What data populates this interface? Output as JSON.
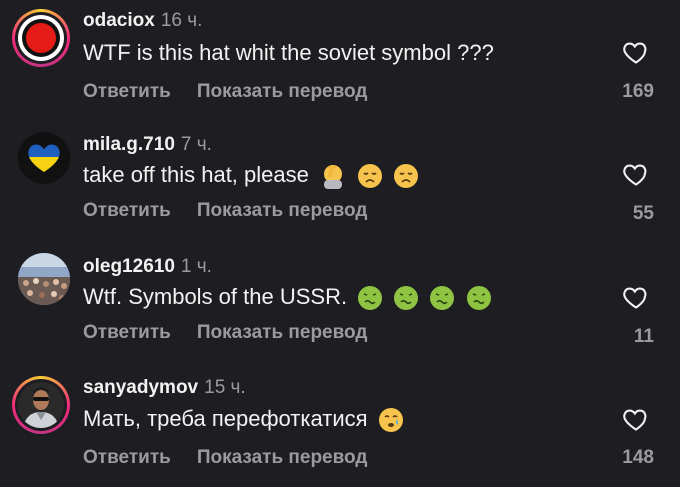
{
  "comments": [
    {
      "username": "odaciox",
      "time": "16 ч.",
      "text": "WTF is this hat whit the soviet symbol ???",
      "reply_label": "Ответить",
      "translate_label": "Показать перевод",
      "likes": "169",
      "avatar_icon": "red-circle-avatar",
      "has_story_ring": true
    },
    {
      "username": "mila.g.710",
      "time": "7 ч.",
      "text": "take off this hat, please",
      "emojis": [
        "facepalm",
        "disappointed",
        "disappointed"
      ],
      "reply_label": "Ответить",
      "translate_label": "Показать перевод",
      "likes": "55",
      "avatar_icon": "ukraine-heart-avatar",
      "has_story_ring": false
    },
    {
      "username": "oleg12610",
      "time": "1 ч.",
      "text": "Wtf. Symbols of the USSR.",
      "emojis": [
        "nauseated",
        "nauseated",
        "nauseated",
        "nauseated"
      ],
      "reply_label": "Ответить",
      "translate_label": "Показать перевод",
      "likes": "11",
      "avatar_icon": "crowd-photo-avatar",
      "has_story_ring": false
    },
    {
      "username": "sanyadymov",
      "time": "15 ч.",
      "text": "Мать, треба перефоткатися",
      "emojis": [
        "crying"
      ],
      "reply_label": "Ответить",
      "translate_label": "Показать перевод",
      "likes": "148",
      "avatar_icon": "person-photo-avatar",
      "has_story_ring": true
    }
  ],
  "colors": {
    "background": "#1e1e22",
    "primary_text": "#f2f2f2",
    "secondary_text": "#9a9aa0",
    "story_ring": [
      "#f9ce34",
      "#ee2a7b",
      "#c13584"
    ],
    "ukraine_blue": "#1f5fbf",
    "ukraine_yellow": "#f5d312"
  }
}
